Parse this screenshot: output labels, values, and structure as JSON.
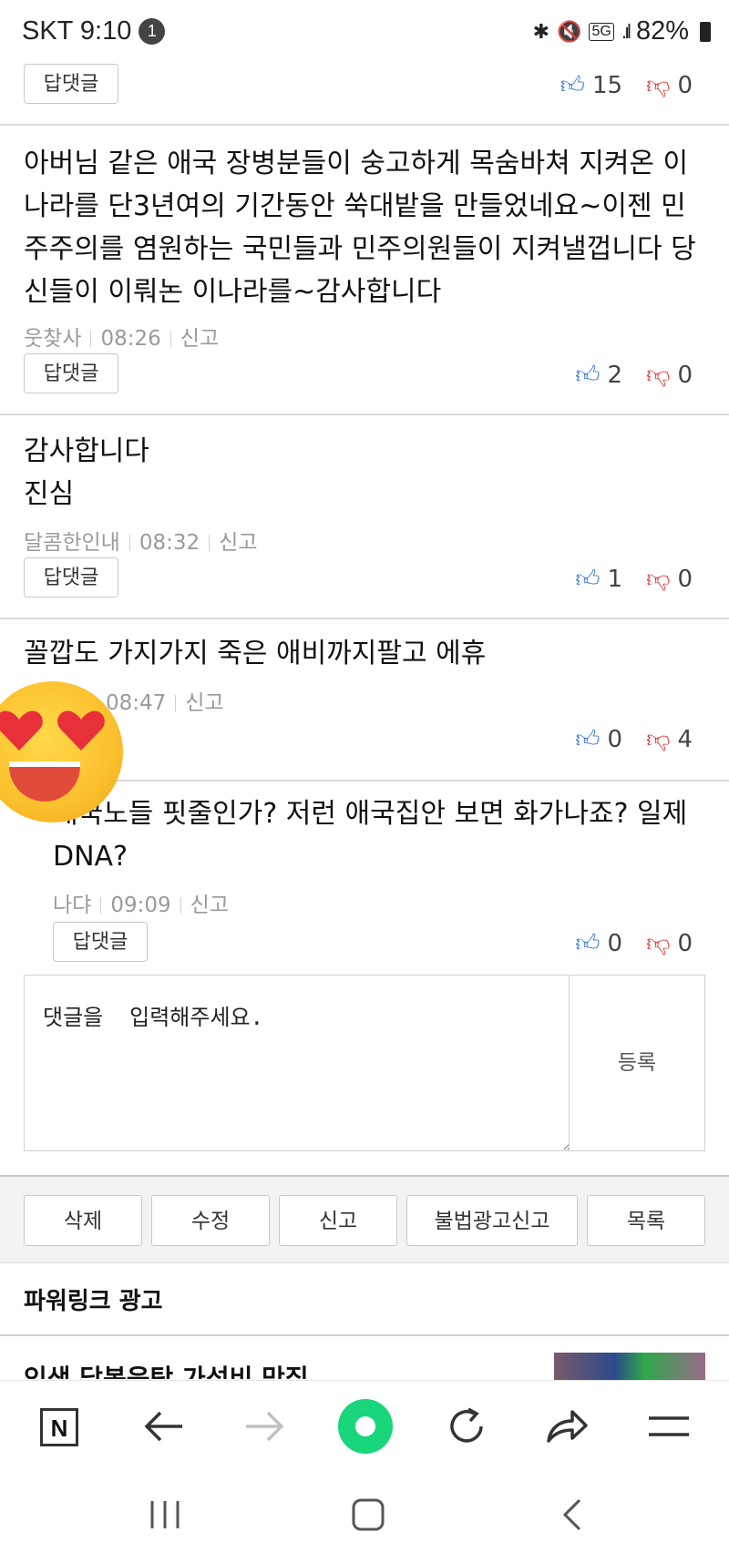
{
  "status_bar": {
    "carrier_time": "SKT 9:10",
    "notification_count": "1",
    "icons": [
      "bluetooth-icon",
      "mute-icon",
      "5g-icon",
      "signal-icon"
    ],
    "battery": "82%"
  },
  "comments": [
    {
      "text": "",
      "author": "",
      "time": "",
      "reply_label": "답댓글",
      "likes": "15",
      "dislikes": "0"
    },
    {
      "text": "아버님 같은 애국 장병분들이 숭고하게 목숨바쳐 지켜온 이나라를 단3년여의 기간동안 쑥대밭을 만들었네요~이젠 민주주의를 염원하는 국민들과 민주의원들이 지켜낼껍니다 당신들이 이뤄논 이나라를~감사합니다",
      "author": "웃찾사",
      "time": "08:26",
      "report": "신고",
      "reply_label": "답댓글",
      "likes": "2",
      "dislikes": "0"
    },
    {
      "text": "감사합니다\n진심",
      "author": "달콤한인내",
      "time": "08:32",
      "report": "신고",
      "reply_label": "답댓글",
      "likes": "1",
      "dislikes": "0"
    },
    {
      "text": "꼴깝도 가지가지 죽은 애비까지팔고 에휴",
      "author": "",
      "time": "08:47",
      "report": "신고",
      "likes": "0",
      "dislikes": "4"
    },
    {
      "text": "매국노들 핏줄인가? 저런 애국집안 보면 화가나죠? 일제DNA?",
      "author": "나댜",
      "time": "09:09",
      "report": "신고",
      "reply_label": "답댓글",
      "likes": "0",
      "dislikes": "0"
    }
  ],
  "comment_input": {
    "placeholder": "댓글을  입력해주세요.",
    "submit_label": "등록"
  },
  "actions": [
    "삭제",
    "수정",
    "신고",
    "불법광고신고",
    "목록"
  ],
  "ads": {
    "heading": "파워링크 광고",
    "first_title": "인생 닭볶음탕 가성비 맛집"
  },
  "browser_nav": {
    "home_label": "N"
  }
}
